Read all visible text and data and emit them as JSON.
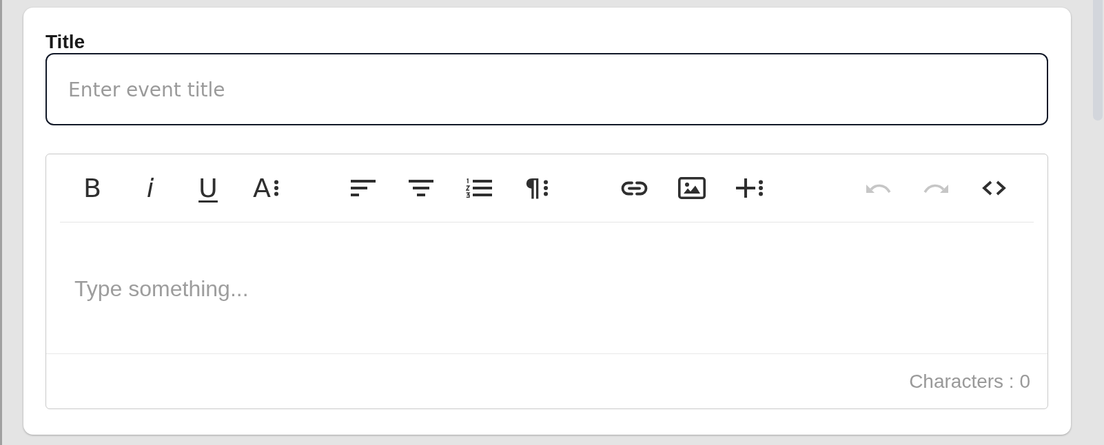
{
  "title_field": {
    "label": "Title",
    "placeholder": "Enter event title"
  },
  "editor": {
    "toolbar": {
      "groups": [
        {
          "buttons": [
            {
              "kind": "bold",
              "label": "B",
              "dropdown": false,
              "disabled": false
            },
            {
              "kind": "italic",
              "label": "i",
              "dropdown": false,
              "disabled": false
            },
            {
              "kind": "underline",
              "label": "U",
              "dropdown": false,
              "disabled": false
            },
            {
              "kind": "fontsize",
              "label": "A",
              "dropdown": true,
              "disabled": false
            }
          ]
        },
        {
          "buttons": [
            {
              "kind": "alignleft",
              "dropdown": false,
              "disabled": false
            },
            {
              "kind": "aligncenter",
              "dropdown": false,
              "disabled": false
            },
            {
              "kind": "orderedlist",
              "dropdown": false,
              "disabled": false
            },
            {
              "kind": "paragraph",
              "label": "¶",
              "dropdown": true,
              "disabled": false
            }
          ]
        },
        {
          "buttons": [
            {
              "kind": "link",
              "dropdown": false,
              "disabled": false
            },
            {
              "kind": "image",
              "dropdown": false,
              "disabled": false
            },
            {
              "kind": "insert",
              "dropdown": true,
              "disabled": false
            }
          ]
        },
        {
          "buttons": [
            {
              "kind": "undo",
              "dropdown": false,
              "disabled": true
            },
            {
              "kind": "redo",
              "dropdown": false,
              "disabled": true
            },
            {
              "kind": "source",
              "dropdown": false,
              "disabled": false
            }
          ]
        }
      ]
    },
    "placeholder": "Type something...",
    "status": "Characters : 0"
  }
}
